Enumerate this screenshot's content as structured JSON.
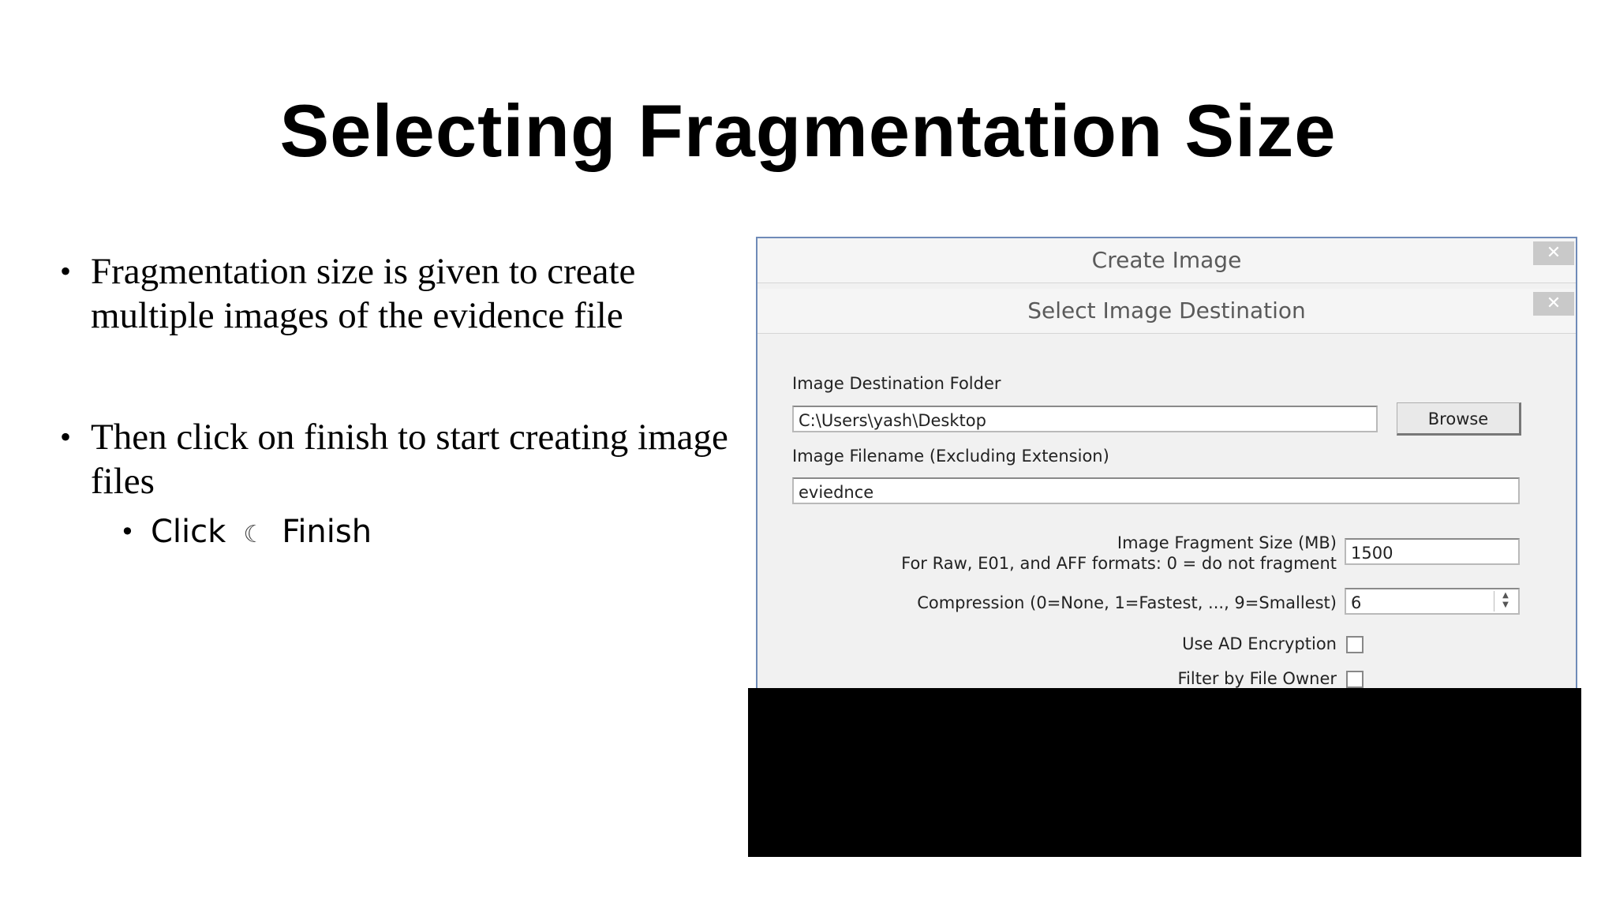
{
  "slide": {
    "title": "Selecting Fragmentation Size",
    "bullets": [
      {
        "text": "Fragmentation size is given to create multiple images of the evidence file"
      },
      {
        "text": "Then click on finish to start creating image files"
      }
    ],
    "sub_bullet": {
      "prefix": "Click",
      "arrow": "☾",
      "suffix": "Finish"
    }
  },
  "screenshot": {
    "outer_title": "Create Image",
    "inner_title": "Select Image Destination",
    "close_glyph": "✕",
    "destination_label": "Image Destination Folder",
    "destination_value": "C:\\Users\\yash\\Desktop",
    "browse_label": "Browse",
    "filename_label": "Image Filename (Excluding Extension)",
    "filename_value": "eviednce",
    "fragment_label": "Image Fragment Size (MB)",
    "fragment_note": "For Raw, E01, and AFF formats: 0 = do not fragment",
    "fragment_value": "1500",
    "compression_label": "Compression (0=None, 1=Fastest, ..., 9=Smallest)",
    "compression_value": "6",
    "encryption_label": "Use AD Encryption",
    "filter_label": "Filter by File Owner"
  }
}
